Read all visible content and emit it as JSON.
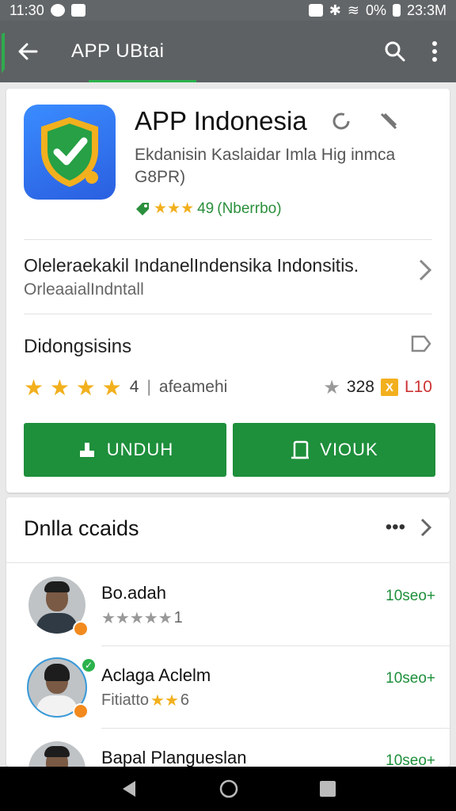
{
  "status": {
    "time": "11:30",
    "battery": "0%",
    "clock": "23:3M"
  },
  "appbar": {
    "title": "APP UBtai"
  },
  "app": {
    "title": "APP Indonesia",
    "subtitle": "Ekdanisin Kaslaidar Imla Hig inmca G8PR)",
    "rating_text": "★★★49 (Nberrbo)",
    "rating_value": "49",
    "rating_count": "(Nberrbo)"
  },
  "description": {
    "line1": "Oleleraekakil IndanelIndensika Indonsitis.",
    "line2": "OrleaaialIndntall"
  },
  "details": {
    "title": "Didongsisins",
    "rating_num": "4",
    "rating_label": "afeamehi",
    "count": "328",
    "count2": "L10"
  },
  "buttons": {
    "download": "UNDUH",
    "view": "VIOUK"
  },
  "reviews": {
    "title": "Dnlla ccaids",
    "items": [
      {
        "name": "Bo.adah",
        "sub_text": "",
        "sub_num": "1",
        "value": "10seo+"
      },
      {
        "name": "Aclaga Aclelm",
        "sub_text": "Fitiatto",
        "sub_num": "6",
        "value": "10seo+"
      },
      {
        "name": "Bapal Plangueslan",
        "sub_text": "",
        "sub_num": "",
        "value": "10seo+"
      }
    ]
  },
  "colors": {
    "accent": "#1e8f3b",
    "appbar": "#5d6163",
    "star": "#f2b01e"
  }
}
